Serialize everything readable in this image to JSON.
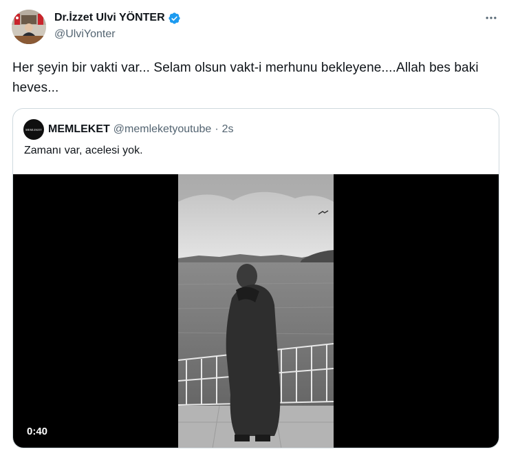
{
  "tweet": {
    "display_name": "Dr.İzzet Ulvi YÖNTER",
    "handle": "@UlviYonter",
    "text": "Her şeyin bir vakti var... Selam olsun vakt-i merhunu bekleyene....Allah bes baki heves..."
  },
  "icons": {
    "verified": "verified-badge-icon",
    "more": "more-options-icon"
  },
  "colors": {
    "verified": "#1d9bf0",
    "secondary_text": "#536471",
    "primary_text": "#0f1419",
    "border": "#cfd9de"
  },
  "quote": {
    "avatar_text": "MEMLEKET",
    "display_name": "MEMLEKET",
    "handle": "@memleketyoutube",
    "separator": "·",
    "time": "2s",
    "text": "Zamanı var, acelesi yok.",
    "video_duration": "0:40"
  }
}
